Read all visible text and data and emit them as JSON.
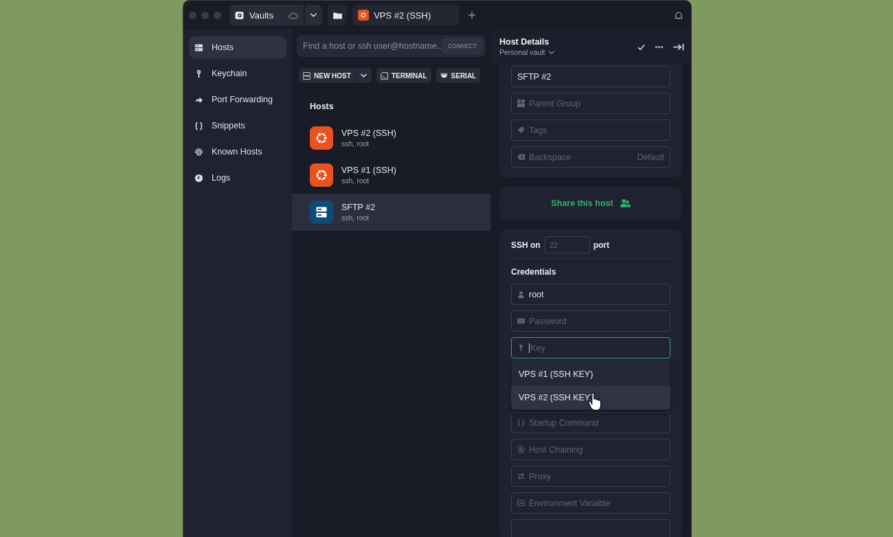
{
  "titlebar": {
    "vault_tab": {
      "label": "Vaults"
    },
    "tabs": [
      {
        "label": "VPS #2 (SSH)",
        "kind": "ubuntu",
        "selected": true
      }
    ]
  },
  "sidebar": {
    "items": [
      {
        "label": "Hosts",
        "kind": "hosts",
        "selected": true
      },
      {
        "label": "Keychain",
        "kind": "key",
        "selected": false
      },
      {
        "label": "Port Forwarding",
        "kind": "forward",
        "selected": false
      },
      {
        "label": "Snippets",
        "kind": "braces",
        "selected": false
      },
      {
        "label": "Known Hosts",
        "kind": "fingerprint",
        "selected": false
      },
      {
        "label": "Logs",
        "kind": "clock",
        "selected": false
      }
    ]
  },
  "search": {
    "placeholder": "Find a host or ssh user@hostname..",
    "button": "CONNECT"
  },
  "toolbar": [
    {
      "label": "NEW HOST",
      "kind": "split"
    },
    {
      "label": "TERMINAL",
      "kind": "terminal"
    },
    {
      "label": "SERIAL",
      "kind": "serial"
    }
  ],
  "hosts": {
    "title": "Hosts",
    "items": [
      {
        "name": "VPS #2 (SSH)",
        "detail": "ssh, root",
        "kind": "ubuntu",
        "selected": false
      },
      {
        "name": "VPS #1 (SSH)",
        "detail": "ssh, root",
        "kind": "ubuntu",
        "selected": false
      },
      {
        "name": "SFTP #2",
        "detail": "ssh, root",
        "kind": "server",
        "selected": true
      }
    ]
  },
  "details": {
    "title": "Host Details",
    "vault": "Personal vault",
    "label_value": "SFTP #2",
    "fields": [
      {
        "kind": "group",
        "placeholder": "Parent Group"
      },
      {
        "kind": "tag",
        "placeholder": "Tags"
      },
      {
        "kind": "backspace",
        "placeholder": "Backspace",
        "trailing": "Default"
      }
    ],
    "share": "Share this host",
    "ssh": {
      "label": "SSH on",
      "port_placeholder": "22",
      "suffix": "port"
    },
    "credentials": {
      "title": "Credentials",
      "username": "root",
      "password_placeholder": "Password",
      "key_placeholder": "Key",
      "key_focused": true
    },
    "key_options": [
      {
        "label": "VPS #1 (SSH KEY)",
        "selected": false
      },
      {
        "label": "VPS #2 (SSH KEY)",
        "selected": true
      }
    ],
    "more_fields": [
      {
        "kind": "snippet",
        "placeholder": "Startup Command"
      },
      {
        "kind": "chain",
        "placeholder": "Host Chaining"
      },
      {
        "kind": "proxy",
        "placeholder": "Proxy"
      },
      {
        "kind": "env",
        "placeholder": "Environment Variable"
      }
    ]
  }
}
